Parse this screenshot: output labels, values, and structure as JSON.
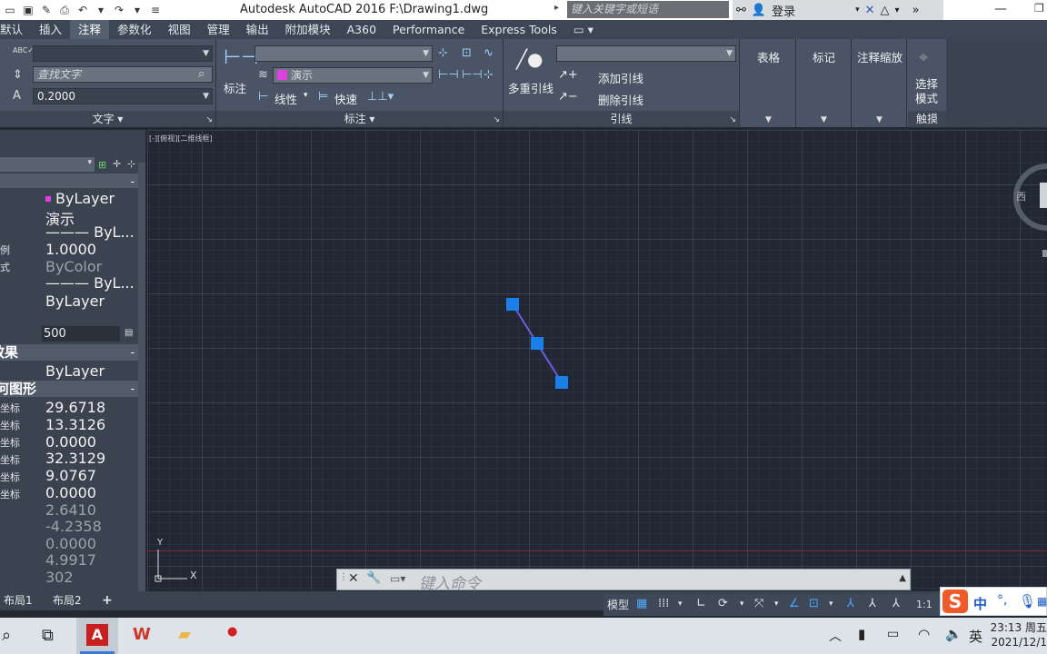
{
  "titlebar": {
    "app_title": "Autodesk AutoCAD 2016    F:\\Drawing1.dwg",
    "search_placeholder": "键入关键字或短语",
    "login_label": "登录"
  },
  "tabs": [
    "默认",
    "插入",
    "注释",
    "参数化",
    "视图",
    "管理",
    "输出",
    "附加模块",
    "A360",
    "Performance",
    "Express Tools"
  ],
  "active_tab": "注释",
  "ribbon": {
    "text_panel": {
      "title": "文字",
      "find_text_placeholder": "查找文字",
      "height_value": "0.2000"
    },
    "dimension_panel": {
      "title": "标注",
      "dim_label": "标注",
      "layer_value": "演示",
      "linear_label": "线性",
      "quick_label": "快速"
    },
    "leader_panel": {
      "title": "引线",
      "multileader_label": "多重引线",
      "add_leader_label": "添加引线",
      "remove_leader_label": "删除引线"
    },
    "table_label": "表格",
    "markup_label": "标记",
    "annotation_scale_label": "注释缩放",
    "select_mode_label": "选择\n模式",
    "touch_label": "触摸"
  },
  "properties": {
    "rows": [
      {
        "label": "",
        "value": "ByLayer",
        "swatch": "#e040e0"
      },
      {
        "label": "",
        "value": "演示"
      },
      {
        "label": "",
        "value": "——— ByL..."
      },
      {
        "label": "例",
        "value": "1.0000"
      },
      {
        "label": "式",
        "value": "ByColor",
        "gray": true
      },
      {
        "label": "",
        "value": "——— ByL..."
      },
      {
        "label": "",
        "value": "ByLayer"
      }
    ],
    "thickness_value": "500",
    "section_3d": "效果",
    "section_3d_value": "ByLayer",
    "section_geom": "几何图形",
    "coords": [
      {
        "label": "坐标",
        "value": "29.6718"
      },
      {
        "label": "坐标",
        "value": "13.3126"
      },
      {
        "label": "坐标",
        "value": "0.0000"
      },
      {
        "label": "坐标",
        "value": "32.3129"
      },
      {
        "label": "坐标",
        "value": "9.0767"
      },
      {
        "label": "坐标",
        "value": "0.0000"
      }
    ],
    "deltas": [
      "2.6410",
      "-4.2358",
      "0.0000",
      "4.9917",
      "302"
    ]
  },
  "canvas": {
    "viewport_label": "[-][俯视][二维线框]",
    "compass_west": "西",
    "ucs_y": "Y",
    "ucs_x": "X",
    "line_color": "#6a5fe0",
    "grip_color": "#1a7fe8"
  },
  "command": {
    "placeholder": "键入命令"
  },
  "layout_tabs": [
    "布局1",
    "布局2"
  ],
  "status": {
    "model_label": "模型",
    "scale_label": "1:1"
  },
  "ime": {
    "lang": "中"
  },
  "taskbar": {
    "lang": "英",
    "time": "23:13 周五",
    "date": "2021/12/1"
  }
}
